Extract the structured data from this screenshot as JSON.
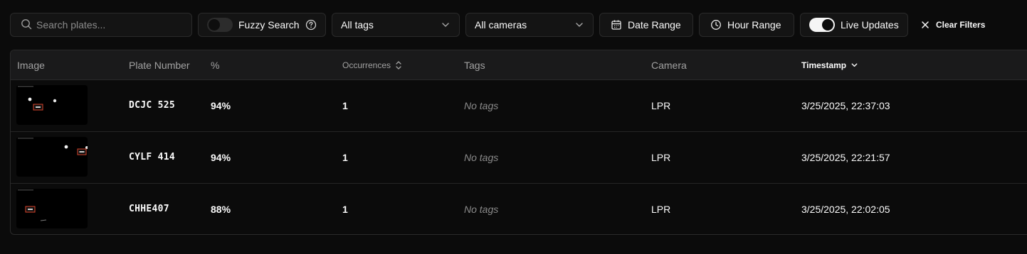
{
  "toolbar": {
    "search": {
      "placeholder": "Search plates...",
      "value": ""
    },
    "fuzzy_search": {
      "label": "Fuzzy Search",
      "enabled": false
    },
    "tags_select": {
      "value": "All tags"
    },
    "cameras_select": {
      "value": "All cameras"
    },
    "date_range": {
      "label": "Date Range"
    },
    "hour_range": {
      "label": "Hour Range"
    },
    "live_updates": {
      "label": "Live Updates",
      "enabled": true
    },
    "clear_filters": {
      "label": "Clear Filters"
    }
  },
  "table": {
    "columns": [
      "Image",
      "Plate Number",
      "%",
      "Occurrences",
      "Tags",
      "Camera",
      "Timestamp"
    ],
    "sort_column": "Timestamp",
    "sort_direction": "descending",
    "rows": [
      {
        "plate": "DCJC 525",
        "confidence": "94%",
        "occurrences": "1",
        "tags": "No tags",
        "camera": "LPR",
        "timestamp": "3/25/2025, 22:37:03"
      },
      {
        "plate": "CYLF 414",
        "confidence": "94%",
        "occurrences": "1",
        "tags": "No tags",
        "camera": "LPR",
        "timestamp": "3/25/2025, 22:21:57"
      },
      {
        "plate": "CHHE407",
        "confidence": "88%",
        "occurrences": "1",
        "tags": "No tags",
        "camera": "LPR",
        "timestamp": "3/25/2025, 22:02:05"
      }
    ]
  }
}
